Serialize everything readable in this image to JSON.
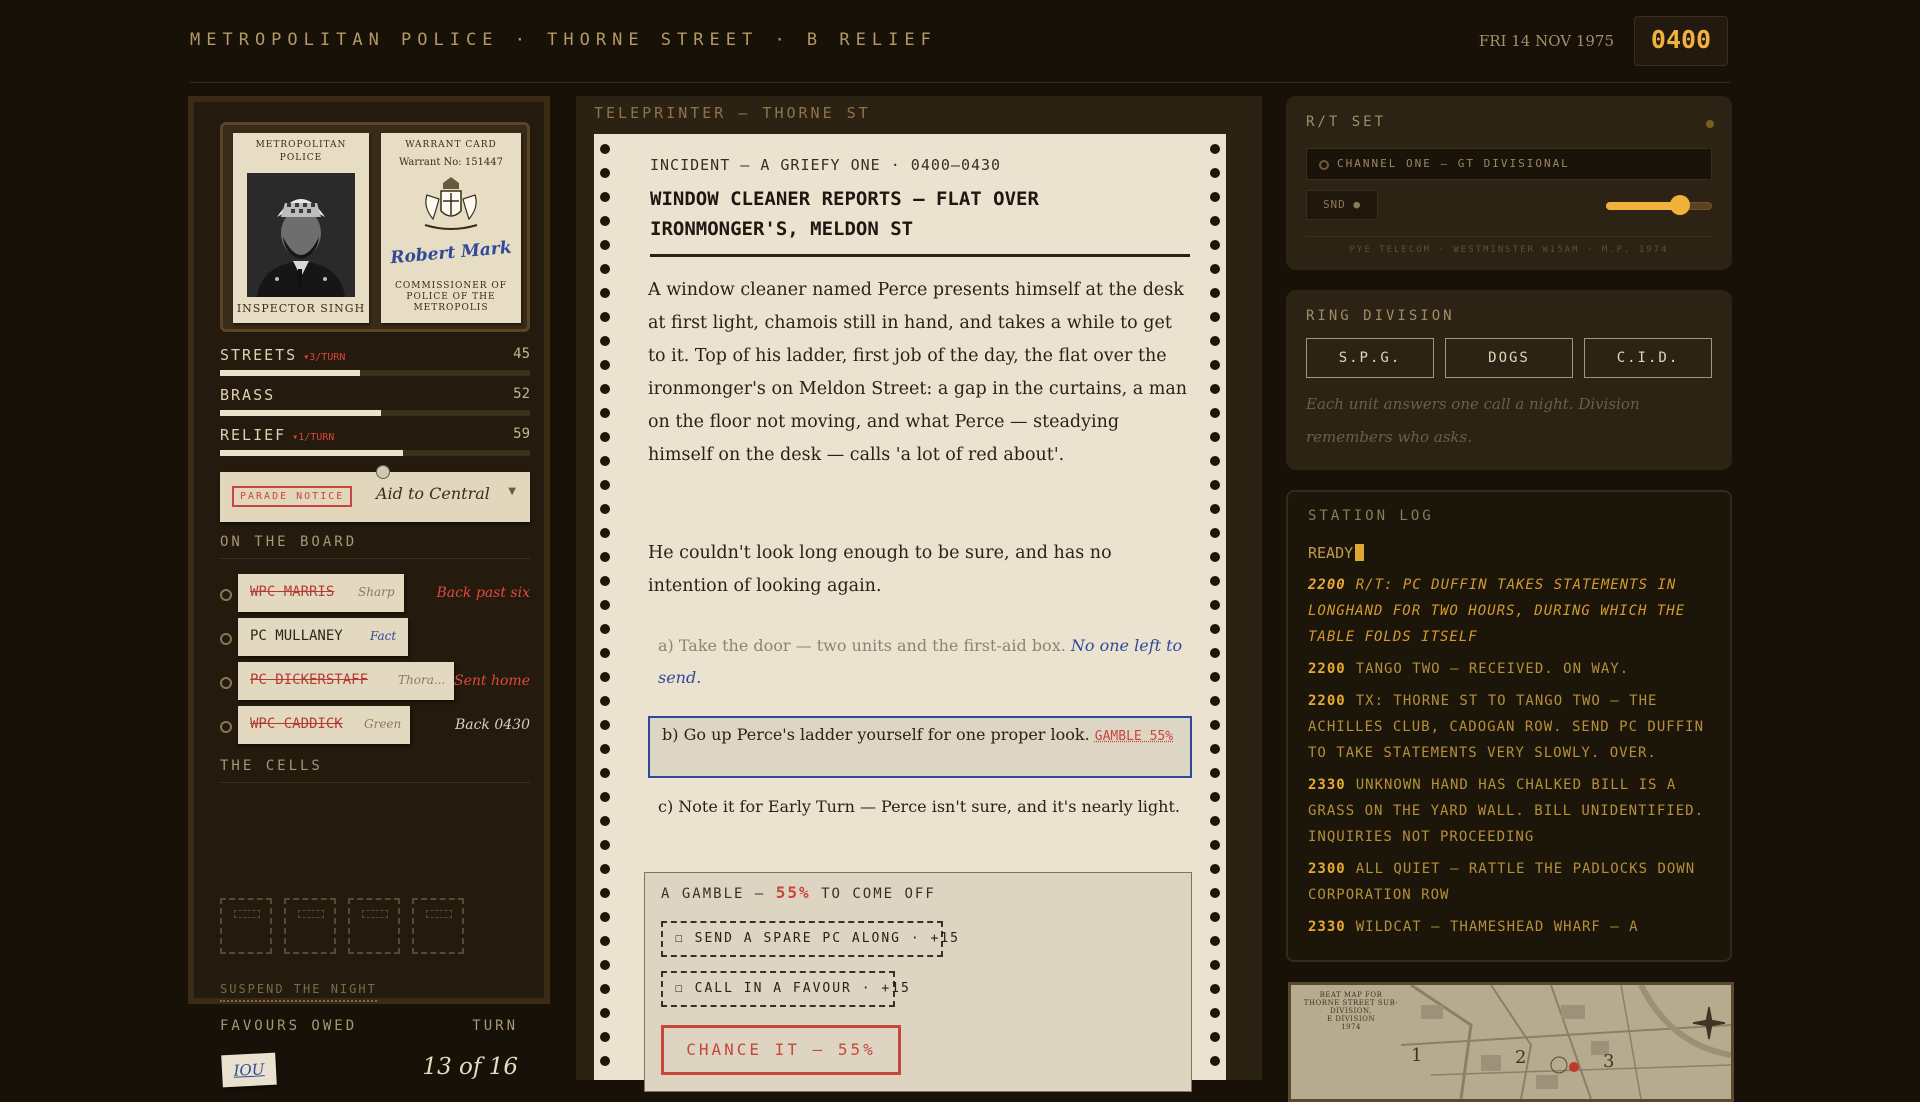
{
  "header": {
    "title": "METROPOLITAN POLICE · THORNE STREET · B RELIEF",
    "date": "FRI 14 NOV 1975",
    "clock": "0400"
  },
  "id_card": {
    "line1": "METROPOLITAN",
    "line2": "POLICE",
    "name": "INSPECTOR SINGH"
  },
  "warrant_card": {
    "title": "WARRANT CARD",
    "number": "Warrant No: 151447",
    "signature": "Robert Mark",
    "line1": "COMMISSIONER OF",
    "line2": "POLICE OF THE",
    "line3": "METROPOLIS"
  },
  "meters": [
    {
      "label": "STREETS",
      "rate": "▾3/TURN",
      "value": 45,
      "fill_pct": 45
    },
    {
      "label": "BRASS",
      "rate": "",
      "value": 52,
      "fill_pct": 52
    },
    {
      "label": "RELIEF",
      "rate": "▾1/TURN",
      "value": 59,
      "fill_pct": 59
    }
  ],
  "notice": {
    "tag": "PARADE NOTICE",
    "value": "Aid to Central"
  },
  "board": {
    "title": "ON THE BOARD",
    "officers": [
      {
        "name": "WPC MARRIS",
        "trait": "Sharp",
        "status": "Back past six",
        "struck": true,
        "status_red": true
      },
      {
        "name": "PC MULLANEY",
        "trait": "Fact",
        "status": "",
        "struck": false,
        "status_red": false
      },
      {
        "name": "PC DICKERSTAFF",
        "trait": "Thora...",
        "status": "Sent home",
        "struck": true,
        "status_red": true
      },
      {
        "name": "WPC CADDICK",
        "trait": "Green",
        "status": "Back 0430",
        "struck": true,
        "status_red": false
      }
    ]
  },
  "cells": {
    "title": "THE CELLS"
  },
  "footer_left": {
    "suspend": "SUSPEND THE NIGHT",
    "favours_label": "FAVOURS OWED",
    "turn_label": "TURN",
    "iou": "IOU",
    "turn_value": "13 of 16"
  },
  "teleprinter": {
    "title": "TELEPRINTER — THORNE ST",
    "incident_head": "INCIDENT — A GRIEFY ONE · 0400–0430",
    "incident_title": "WINDOW CLEANER REPORTS — FLAT OVER IRONMONGER'S, MELDON ST",
    "body_1": "A window cleaner named Perce presents himself at the desk at first light, chamois still in hand, and takes a while to get to it. Top of his ladder, first job of the day, the flat over the ironmonger's on Meldon Street: a gap in the curtains, a man on the floor not moving, and what Perce — steadying himself on the desk — calls 'a lot of red about'.",
    "body_2": "He couldn't look long enough to be sure, and has no intention of looking again.",
    "option_a": "a) Take the door — two units and the first-aid box.",
    "option_a_note": "No one left to send.",
    "option_b": "b) Go up Perce's ladder yourself for one proper look.",
    "option_b_tag": "GAMBLE 55%",
    "option_c": "c) Note it for Early Turn — Perce isn't sure, and it's nearly light.",
    "gamble_label": "A GAMBLE —",
    "gamble_pct": "55%",
    "gamble_suffix": "TO COME OFF",
    "gamble_opt1": "☐ SEND A SPARE PC ALONG · +15",
    "gamble_opt2": "☐ CALL IN A FAVOUR · +15",
    "chance_button": "CHANCE IT — 55%"
  },
  "rt_set": {
    "title": "R/T SET",
    "channel": "CHANNEL ONE — GT DIVISIONAL",
    "snd": "SND ●",
    "volume_pct": 70,
    "maker": "PYE TELECOM · WESTMINSTER W15AM · M.P. 1974"
  },
  "ring_division": {
    "title": "RING DIVISION",
    "buttons": [
      "S.P.G.",
      "DOGS",
      "C.I.D."
    ],
    "note": "Each unit answers one call a night. Division remembers who asks."
  },
  "station_log": {
    "title": "STATION LOG",
    "ready": "READY",
    "entries": [
      {
        "time": "2200",
        "text": "R/T: PC DUFFIN TAKES STATEMENTS IN LONGHAND FOR TWO HOURS, DURING WHICH THE TABLE FOLDS ITSELF",
        "latest": true
      },
      {
        "time": "2200",
        "text": "TANGO TWO — RECEIVED. ON WAY.",
        "latest": false
      },
      {
        "time": "2200",
        "text": "TX: THORNE ST TO TANGO TWO — THE ACHILLES CLUB, CADOGAN ROW. SEND PC DUFFIN TO TAKE STATEMENTS VERY SLOWLY. OVER.",
        "latest": false
      },
      {
        "time": "2330",
        "text": "UNKNOWN HAND HAS CHALKED BILL IS A GRASS ON THE YARD WALL. BILL UNIDENTIFIED. INQUIRIES NOT PROCEEDING",
        "latest": false
      },
      {
        "time": "2300",
        "text": "ALL QUIET — RATTLE THE PADLOCKS DOWN CORPORATION ROW",
        "latest": false
      },
      {
        "time": "2330",
        "text": "WILDCAT — THAMESHEAD WHARF — A",
        "latest": false
      }
    ]
  },
  "map": {
    "caption_1": "BEAT MAP FOR",
    "caption_2": "THORNE STREET SUB-DIVISION,",
    "caption_3": "E DIVISION",
    "caption_4": "1974",
    "beats": [
      "1",
      "2",
      "3"
    ]
  },
  "colors": {
    "amber": "#f0b23a",
    "stamp_red": "#c7473c",
    "ink_blue": "#2f4a9a",
    "paper": "#ebe3d0"
  }
}
